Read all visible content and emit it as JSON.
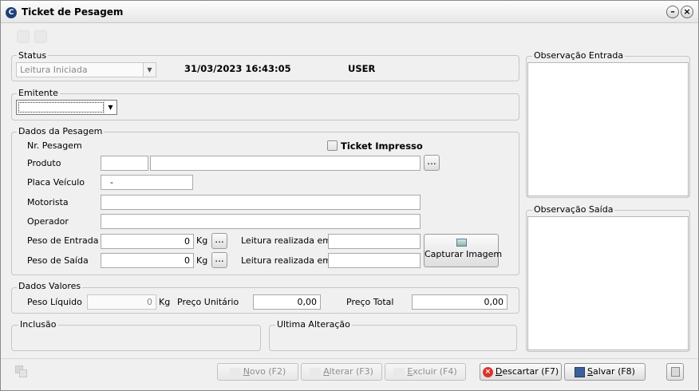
{
  "window": {
    "title": "Ticket de Pesagem",
    "app_icon": "app-logo-icon",
    "minimize_icon": "minimize-icon",
    "close_icon": "close-icon"
  },
  "status": {
    "group_label": "Status",
    "value": "Leitura Iniciada",
    "datetime": "31/03/2023 16:43:05",
    "user": "USER"
  },
  "emitente": {
    "group_label": "Emitente",
    "value": ""
  },
  "pesagem": {
    "group_label": "Dados da Pesagem",
    "nr_label": "Nr. Pesagem",
    "ticket_impresso_label": "Ticket Impresso",
    "produto_label": "Produto",
    "produto_code": "",
    "produto_desc": "",
    "lookup_label": "...",
    "placa_label": "Placa Veículo",
    "placa_value": "-",
    "motorista_label": "Motorista",
    "motorista_value": "",
    "operador_label": "Operador",
    "operador_value": "",
    "peso_entrada_label": "Peso de Entrada",
    "peso_entrada_value": "0",
    "peso_saida_label": "Peso de Saída",
    "peso_saida_value": "0",
    "unit": "Kg",
    "leitura_label": "Leitura realizada em",
    "leitura_entrada_value": "",
    "leitura_saida_value": "",
    "capturar_label": "Capturar Imagem"
  },
  "valores": {
    "group_label": "Dados Valores",
    "peso_liquido_label": "Peso Líquido",
    "peso_liquido_value": "0",
    "unit": "Kg",
    "preco_unitario_label": "Preço Unitário",
    "preco_unitario_value": "0,00",
    "preco_total_label": "Preço Total",
    "preco_total_value": "0,00"
  },
  "inclusao": {
    "group_label": "Inclusão"
  },
  "ultima_alteracao": {
    "group_label": "Ultima Alteração"
  },
  "observacao_entrada": {
    "group_label": "Observação Entrada",
    "value": ""
  },
  "observacao_saida": {
    "group_label": "Observação Saída",
    "value": ""
  },
  "footer": {
    "novo_hot": "N",
    "novo_rest": "ovo (F2)",
    "alterar_hot": "A",
    "alterar_rest": "lterar (F3)",
    "excluir_hot": "E",
    "excluir_rest": "xcluir (F4)",
    "descartar_hot": "D",
    "descartar_rest": "escartar (F7)",
    "salvar_hot": "S",
    "salvar_rest": "alvar (F8)",
    "colors": {
      "discard_icon": "#d9342b"
    }
  }
}
